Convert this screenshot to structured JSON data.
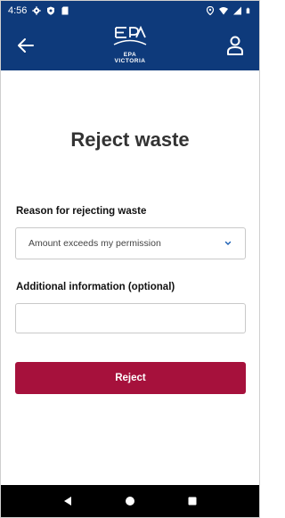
{
  "status_bar": {
    "time": "4:56",
    "left_icons": [
      "settings-icon",
      "shield-icon",
      "sd-card-icon"
    ],
    "right_icons": [
      "location-icon",
      "wifi-icon",
      "signal-icon",
      "battery-icon"
    ]
  },
  "header": {
    "logo_line1": "EPA",
    "logo_line2": "VICTORIA",
    "back_icon": "arrow-left-icon",
    "profile_icon": "user-icon",
    "background": "#0e3a7b"
  },
  "page": {
    "title": "Reject waste"
  },
  "form": {
    "reason_label": "Reason for rejecting waste",
    "reason_value": "Amount exceeds my permission",
    "info_label": "Additional information (optional)",
    "info_value": "",
    "info_placeholder": ""
  },
  "actions": {
    "reject_label": "Reject",
    "reject_color": "#a6113c"
  },
  "navbar": {
    "icons": [
      "back-triangle-icon",
      "home-circle-icon",
      "recents-square-icon"
    ]
  }
}
